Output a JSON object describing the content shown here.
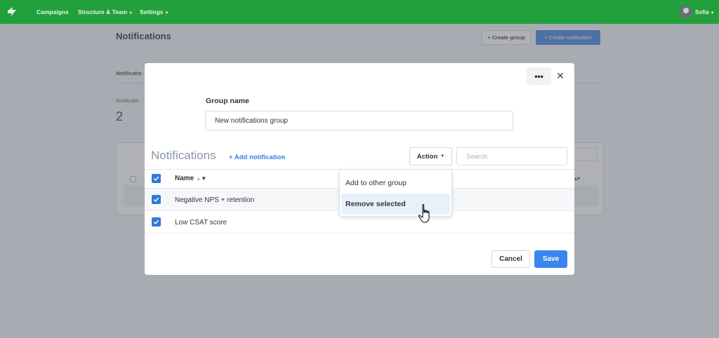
{
  "nav": {
    "items": [
      {
        "label": "Campaigns"
      },
      {
        "label": "Structure & Team"
      },
      {
        "label": "Settings"
      }
    ],
    "user_name": "Sofia",
    "brand_color": "#22a03b"
  },
  "background_page": {
    "title": "Notifications",
    "create_group_label": "+ Create group",
    "create_notification_label": "+ Create notification",
    "tab_label": "Notificatio",
    "stat_label": "Notificatio",
    "stat_value": "2"
  },
  "modal": {
    "more_label": "•••",
    "close_label": "✕",
    "group_name_label": "Group name",
    "group_name_value": "New notifications group",
    "section_title": "Notifications",
    "add_notification_label": "+ Add notification",
    "action_label": "Action",
    "search_placeholder": "Search",
    "table": {
      "column_name": "Name",
      "rows": [
        {
          "name": "Negative NPS + retention",
          "checked": true
        },
        {
          "name": "Low CSAT score",
          "checked": true
        }
      ]
    },
    "action_menu": {
      "items": [
        {
          "label": "Add to other group"
        },
        {
          "label": "Remove selected",
          "hovered": true
        }
      ]
    },
    "cancel_label": "Cancel",
    "save_label": "Save",
    "accent_color": "#3a84ee"
  }
}
